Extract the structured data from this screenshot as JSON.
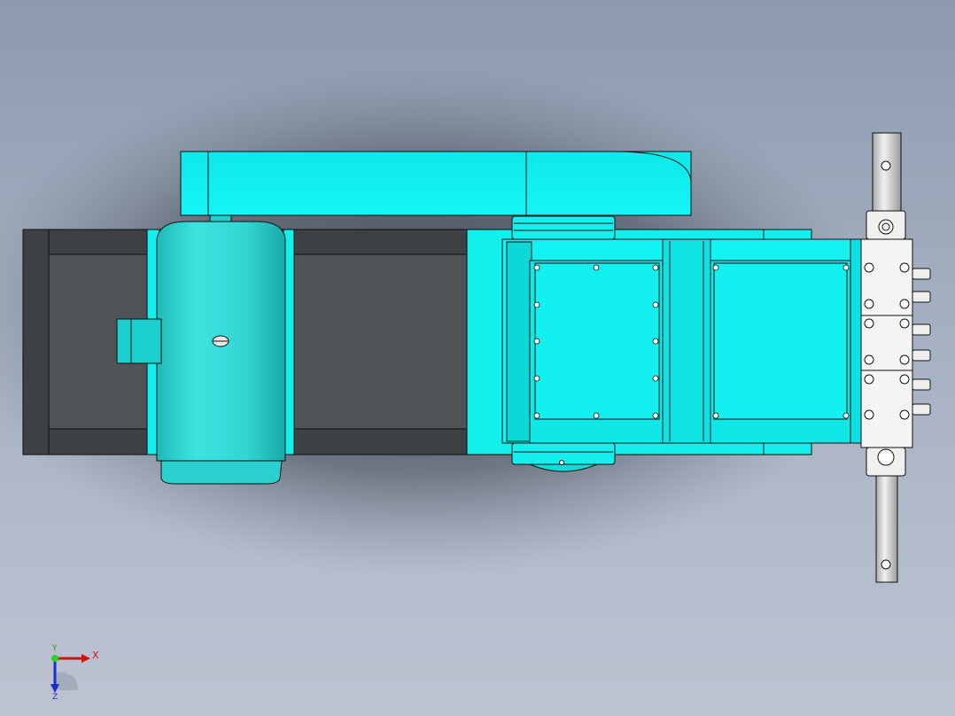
{
  "view": {
    "title": "",
    "background_top": "#8d9aae",
    "background_bottom": "#bcc4d2"
  },
  "model": {
    "description_icon": "cad-assembly-top-view",
    "colors": {
      "body": "#12f2f0",
      "body_shade": "#0ad6d8",
      "motor": "#33d6d4",
      "frame": "#3e4144",
      "frame_inner": "#4d5154",
      "valve_block": "#f4f4f4",
      "pipe": "#d9d9d9",
      "edge": "#101010"
    }
  },
  "triad": {
    "x_label": "X",
    "y_label": "Y",
    "z_label": "Z",
    "x_color": "#d81010",
    "y_color": "#169a16",
    "z_color": "#1a2fd0"
  }
}
